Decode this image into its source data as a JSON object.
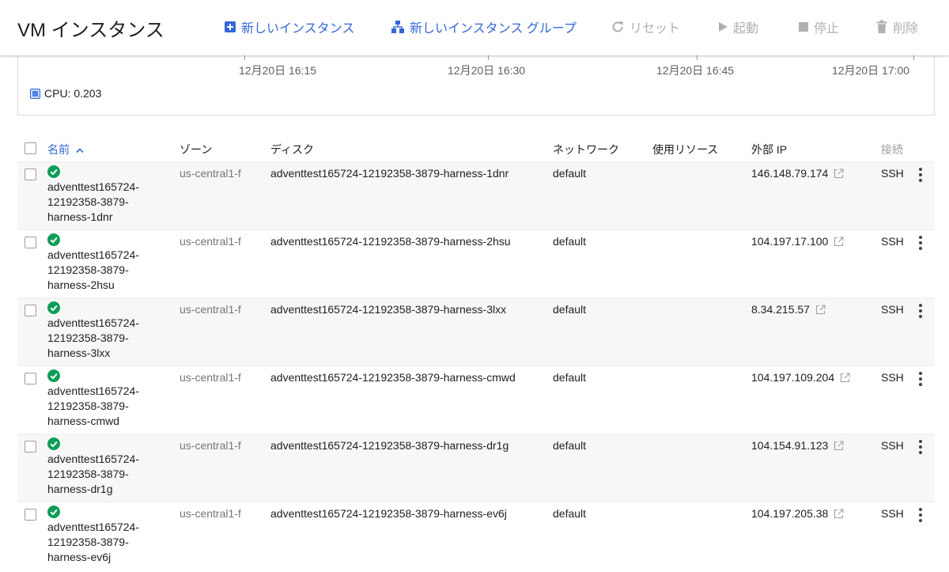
{
  "header": {
    "title": "VM インスタンス",
    "buttons": {
      "new_instance": "新しいインスタンス",
      "new_group": "新しいインスタンス グループ",
      "reset": "リセット",
      "start": "起動",
      "stop": "停止",
      "delete": "削除"
    }
  },
  "chart": {
    "ticks": [
      "12月20日 16:15",
      "12月20日 16:30",
      "12月20日 16:45",
      "12月20日 17:00"
    ],
    "legend": "CPU: 0.203",
    "legend_color": "#4a86e8"
  },
  "table": {
    "columns": {
      "name": "名前",
      "zone": "ゾーン",
      "disk": "ディスク",
      "network": "ネットワーク",
      "usage": "使用リソース",
      "external_ip": "外部 IP",
      "connect": "接続"
    },
    "rows": [
      {
        "name_l1": "adventtest165724-",
        "name_l2": "12192358-3879-",
        "name_l3": "harness-1dnr",
        "zone": "us-central1-f",
        "disk": "adventtest165724-12192358-3879-harness-1dnr",
        "network": "default",
        "ip": "146.148.79.174",
        "connect": "SSH"
      },
      {
        "name_l1": "adventtest165724-",
        "name_l2": "12192358-3879-",
        "name_l3": "harness-2hsu",
        "zone": "us-central1-f",
        "disk": "adventtest165724-12192358-3879-harness-2hsu",
        "network": "default",
        "ip": "104.197.17.100",
        "connect": "SSH"
      },
      {
        "name_l1": "adventtest165724-",
        "name_l2": "12192358-3879-",
        "name_l3": "harness-3lxx",
        "zone": "us-central1-f",
        "disk": "adventtest165724-12192358-3879-harness-3lxx",
        "network": "default",
        "ip": "8.34.215.57",
        "connect": "SSH"
      },
      {
        "name_l1": "adventtest165724-",
        "name_l2": "12192358-3879-",
        "name_l3": "harness-cmwd",
        "zone": "us-central1-f",
        "disk": "adventtest165724-12192358-3879-harness-cmwd",
        "network": "default",
        "ip": "104.197.109.204",
        "connect": "SSH"
      },
      {
        "name_l1": "adventtest165724-",
        "name_l2": "12192358-3879-",
        "name_l3": "harness-dr1g",
        "zone": "us-central1-f",
        "disk": "adventtest165724-12192358-3879-harness-dr1g",
        "network": "default",
        "ip": "104.154.91.123",
        "connect": "SSH"
      },
      {
        "name_l1": "adventtest165724-",
        "name_l2": "12192358-3879-",
        "name_l3": "harness-ev6j",
        "zone": "us-central1-f",
        "disk": "adventtest165724-12192358-3879-harness-ev6j",
        "network": "default",
        "ip": "104.197.205.38",
        "connect": "SSH"
      }
    ]
  },
  "colors": {
    "accent": "#3367d6",
    "status_ok": "#0f9d58",
    "disabled": "#b0b0b0"
  }
}
